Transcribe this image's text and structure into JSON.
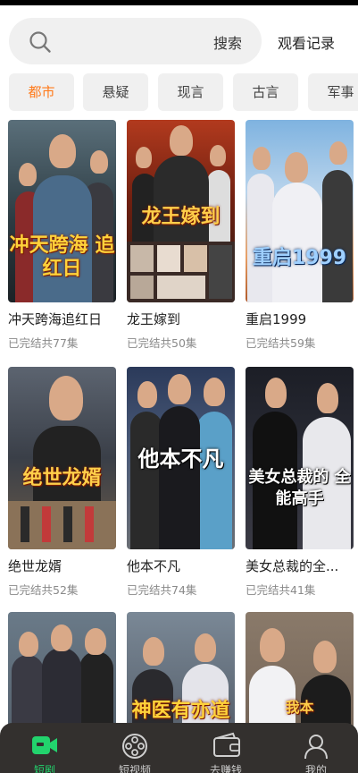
{
  "search": {
    "placeholder_button": "搜索",
    "history_label": "观看记录"
  },
  "categories": [
    "都市",
    "悬疑",
    "现言",
    "古言",
    "军事"
  ],
  "active_category": "都市",
  "dramas": [
    {
      "name": "冲天跨海追红日",
      "status": "已完结共77集",
      "poster_title": "冲天跨海 追红日"
    },
    {
      "name": "龙王嫁到",
      "status": "已完结共50集",
      "poster_title": "龙王嫁到"
    },
    {
      "name": "重启1999",
      "status": "已完结共59集",
      "poster_title": "重启1999"
    },
    {
      "name": "绝世龙婿",
      "status": "已完结共52集",
      "poster_title": "绝世龙婿"
    },
    {
      "name": "他本不凡",
      "status": "已完结共74集",
      "poster_title": "他本不凡"
    },
    {
      "name": "美女总裁的全...",
      "status": "已完结共41集",
      "poster_title": "美女总裁的 全能高手"
    },
    {
      "name": "",
      "status": "",
      "poster_title": ""
    },
    {
      "name": "",
      "status": "",
      "poster_title": "神医有亦道"
    },
    {
      "name": "",
      "status": "",
      "poster_title": "我本"
    }
  ],
  "tabs": [
    {
      "label": "短剧",
      "icon": "video-camera-icon",
      "active": true
    },
    {
      "label": "短视频",
      "icon": "film-reel-icon",
      "active": false
    },
    {
      "label": "去赚钱",
      "icon": "wallet-icon",
      "active": false
    },
    {
      "label": "我的",
      "icon": "person-icon",
      "active": false
    }
  ],
  "colors": {
    "accent": "#ff7a1a",
    "tab_active": "#22d36d",
    "tabbar_bg": "#33302e"
  }
}
